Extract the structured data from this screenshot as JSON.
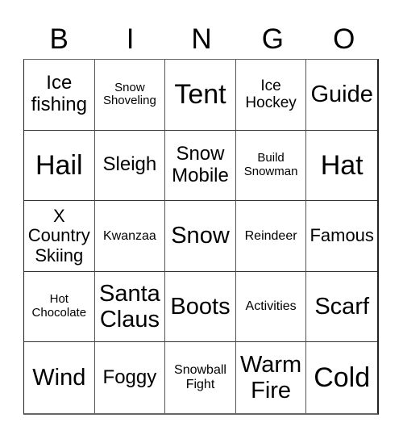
{
  "header": {
    "letters": [
      "B",
      "I",
      "N",
      "G",
      "O"
    ]
  },
  "cells": [
    [
      "Ice fishing",
      "Snow Shoveling",
      "Tent",
      "Ice Hockey",
      "Guide"
    ],
    [
      "Hail",
      "Sleigh",
      "Snow Mobile",
      "Build Snowman",
      "Hat"
    ],
    [
      "X Country Skiing",
      "Kwanzaa",
      "Snow",
      "Reindeer",
      "Famous"
    ],
    [
      "Hot Chocolate",
      "Santa Claus",
      "Boots",
      "Activities",
      "Scarf"
    ],
    [
      "Wind",
      "Foggy",
      "Snowball Fight",
      "Warm Fire",
      "Cold"
    ]
  ],
  "colors": {
    "text": "#000000",
    "grid_line": "#333333",
    "background": "#ffffff"
  }
}
